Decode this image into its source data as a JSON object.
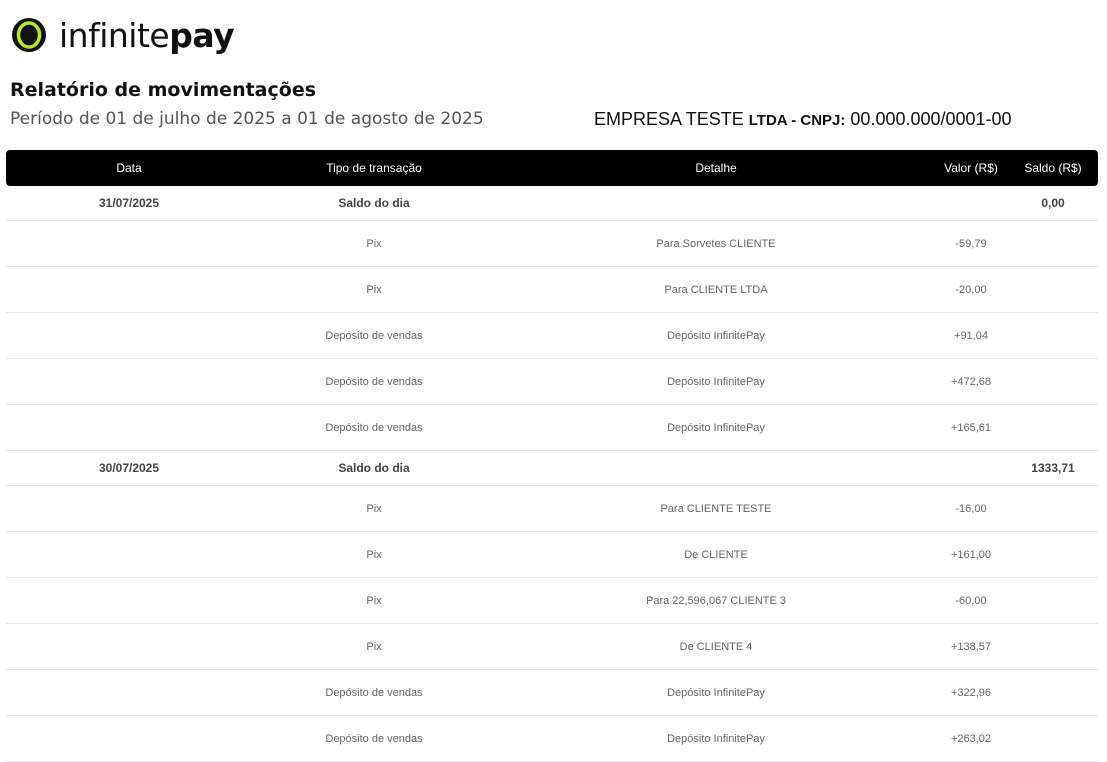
{
  "brand": {
    "name_light": "infinite",
    "name_bold": "pay",
    "ring_color": "#111111",
    "accent_color": "#b8e62d"
  },
  "report": {
    "title": "Relatório de movimentações",
    "period": "Período de 01 de julho de 2025 a 01 de agosto de 2025",
    "company_name": "EMPRESA TESTE",
    "company_suffix": "LTDA - CNPJ:",
    "cnpj": "00.000.000/0001-00"
  },
  "table": {
    "headers": {
      "data": "Data",
      "tipo": "Tipo de transação",
      "detalhe": "Detalhe",
      "valor": "Valor (R$)",
      "saldo": "Saldo (R$)"
    },
    "rows": [
      {
        "kind": "saldo",
        "data": "31/07/2025",
        "tipo": "Saldo do dia",
        "detalhe": "",
        "valor": "",
        "saldo": "0,00"
      },
      {
        "kind": "tx",
        "data": "",
        "tipo": "Pix",
        "detalhe": "Para Sorvetes CLIENTE",
        "valor": "-59,79",
        "saldo": ""
      },
      {
        "kind": "tx",
        "data": "",
        "tipo": "Pix",
        "detalhe": "Para CLIENTE LTDA",
        "valor": "-20,00",
        "saldo": ""
      },
      {
        "kind": "tx",
        "data": "",
        "tipo": "Depósito de vendas",
        "detalhe": "Depósito InfinitePay",
        "valor": "+91,04",
        "saldo": ""
      },
      {
        "kind": "tx",
        "data": "",
        "tipo": "Depósito de vendas",
        "detalhe": "Depósito InfinitePay",
        "valor": "+472,68",
        "saldo": ""
      },
      {
        "kind": "tx",
        "data": "",
        "tipo": "Depósito de vendas",
        "detalhe": "Depósito InfinitePay",
        "valor": "+165,61",
        "saldo": ""
      },
      {
        "kind": "saldo",
        "data": "30/07/2025",
        "tipo": "Saldo do dia",
        "detalhe": "",
        "valor": "",
        "saldo": "1333,71"
      },
      {
        "kind": "tx",
        "data": "",
        "tipo": "Pix",
        "detalhe": "Para CLIENTE TESTE",
        "valor": "-16,00",
        "saldo": ""
      },
      {
        "kind": "tx",
        "data": "",
        "tipo": "Pix",
        "detalhe": "De CLIENTE",
        "valor": "+161,00",
        "saldo": ""
      },
      {
        "kind": "tx",
        "data": "",
        "tipo": "Pix",
        "detalhe": "Para 22,596,067 CLIENTE 3",
        "valor": "-60,00",
        "saldo": ""
      },
      {
        "kind": "tx",
        "data": "",
        "tipo": "Pix",
        "detalhe": "De CLIENTE 4",
        "valor": "+138,57",
        "saldo": ""
      },
      {
        "kind": "tx",
        "data": "",
        "tipo": "Depósito de vendas",
        "detalhe": "Depósito InfinitePay",
        "valor": "+322,96",
        "saldo": ""
      },
      {
        "kind": "tx",
        "data": "",
        "tipo": "Depósito de vendas",
        "detalhe": "Depósito InfinitePay",
        "valor": "+263,02",
        "saldo": ""
      }
    ]
  }
}
